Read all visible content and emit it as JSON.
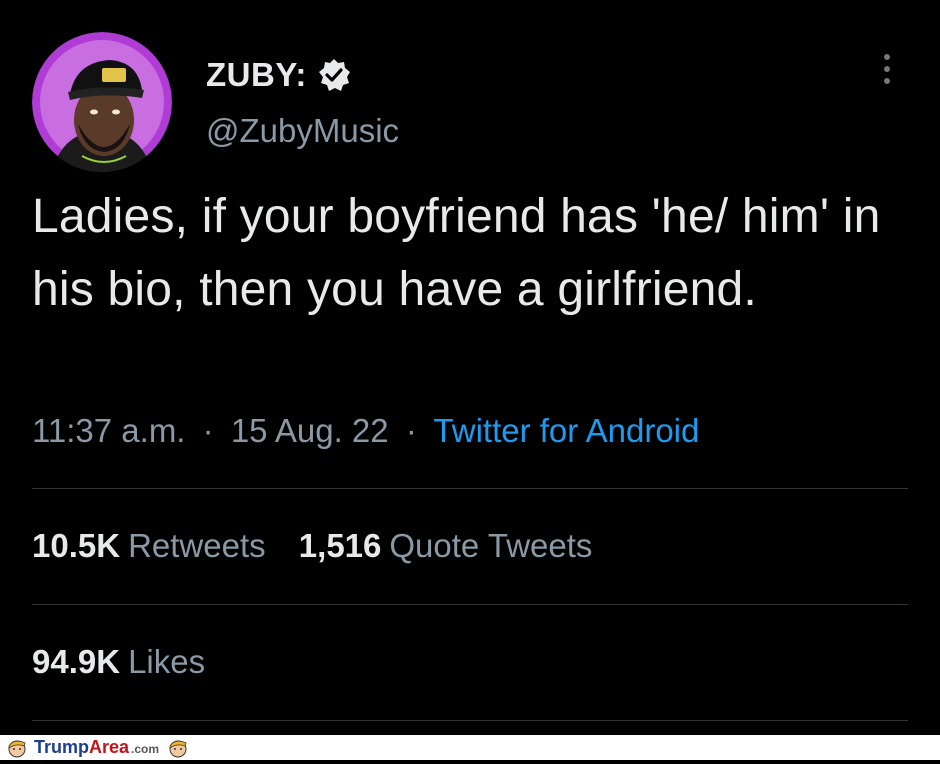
{
  "author": {
    "display_name": "ZUBY:",
    "handle": "@ZubyMusic",
    "verified_icon": "verified-badge-icon",
    "avatar_accent": "#b03cd6"
  },
  "tweet": {
    "text": "Ladies, if your boyfriend has 'he/ him' in his bio, then you have a girlfriend.",
    "time": "11:37 a.m.",
    "date": "15 Aug. 22",
    "separator": "·",
    "source": "Twitter for Android"
  },
  "stats": {
    "retweets_count": "10.5K",
    "retweets_label": "Retweets",
    "quotes_count": "1,516",
    "quotes_label": "Quote Tweets",
    "likes_count": "94.9K",
    "likes_label": "Likes"
  },
  "watermark": {
    "trump": "Trump",
    "area": "Area",
    "com": ".com"
  },
  "colors": {
    "background": "#000000",
    "text_primary": "#e7e9ea",
    "text_secondary": "#8b98a5",
    "link": "#1d9bf0",
    "divider": "#2f3336"
  }
}
